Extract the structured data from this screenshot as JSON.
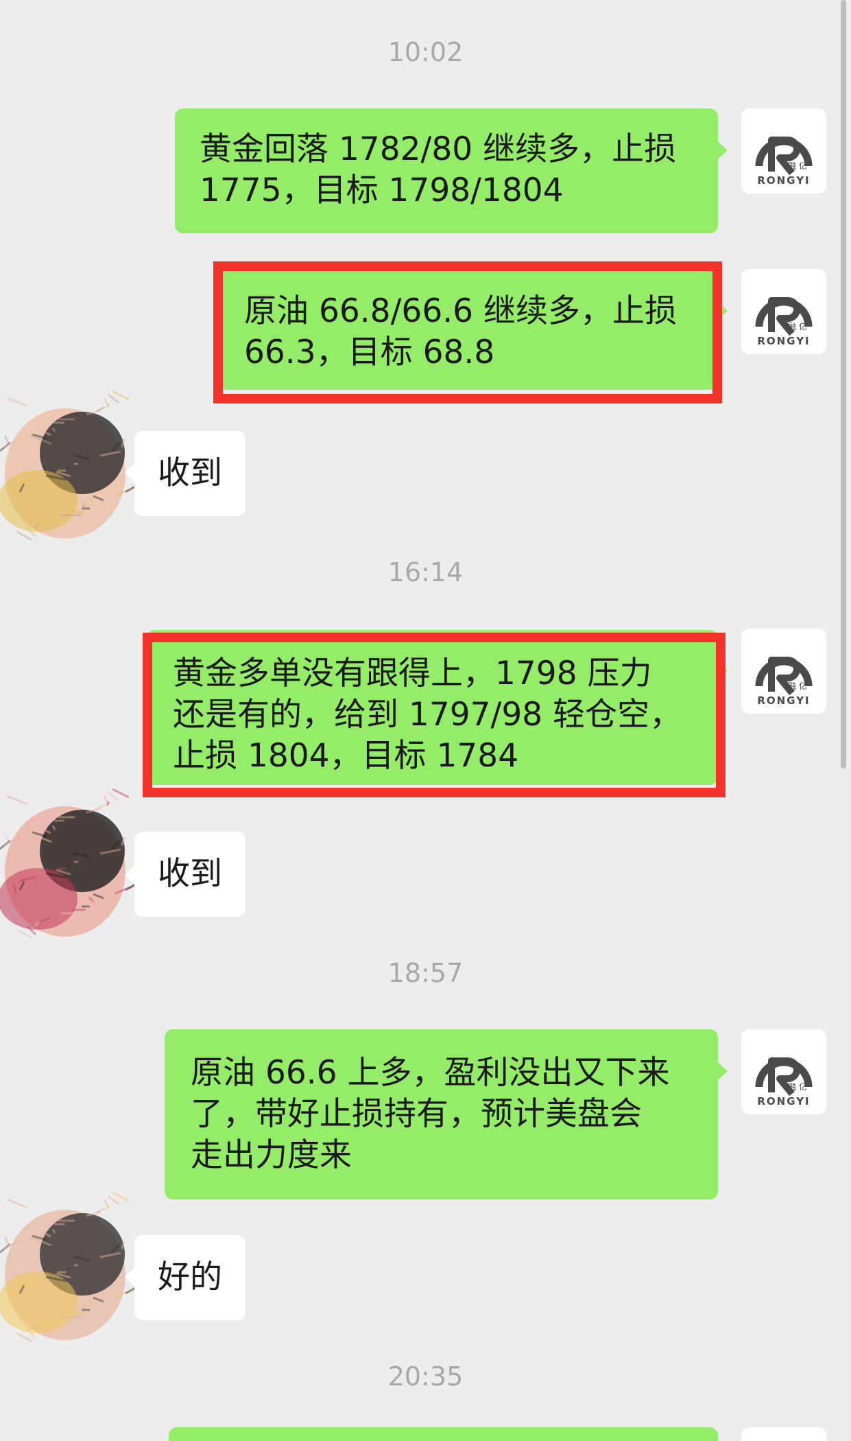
{
  "timestamps": [
    "10:02",
    "16:14",
    "18:57",
    "20:35"
  ],
  "avatar_brand": {
    "chinese": "融 亿",
    "english": "RONGYI"
  },
  "messages": [
    {
      "side": "right",
      "text": "黄金回落 1782/80 继续多，止损\n1775，目标 1798/1804",
      "highlighted": false
    },
    {
      "side": "right",
      "text": "原油 66.8/66.6 继续多，止损\n66.3，目标 68.8",
      "highlighted": true
    },
    {
      "side": "left",
      "text": "收到"
    },
    {
      "side": "right",
      "text": "黄金多单没有跟得上，1798 压力\n还是有的，给到 1797/98 轻仓空，\n止损 1804，目标 1784",
      "highlighted": true
    },
    {
      "side": "left",
      "text": "收到"
    },
    {
      "side": "right",
      "text": "原油 66.6 上多，盈利没出又下来\n了，带好止损持有，预计美盘会\n走出力度来",
      "highlighted": false
    },
    {
      "side": "left",
      "text": "好的"
    }
  ],
  "colors": {
    "background": "#ededed",
    "sent_bubble": "#95ec69",
    "received_bubble": "#ffffff",
    "highlight_box": "#f2332b",
    "timestamp": "#a8a8a8"
  }
}
